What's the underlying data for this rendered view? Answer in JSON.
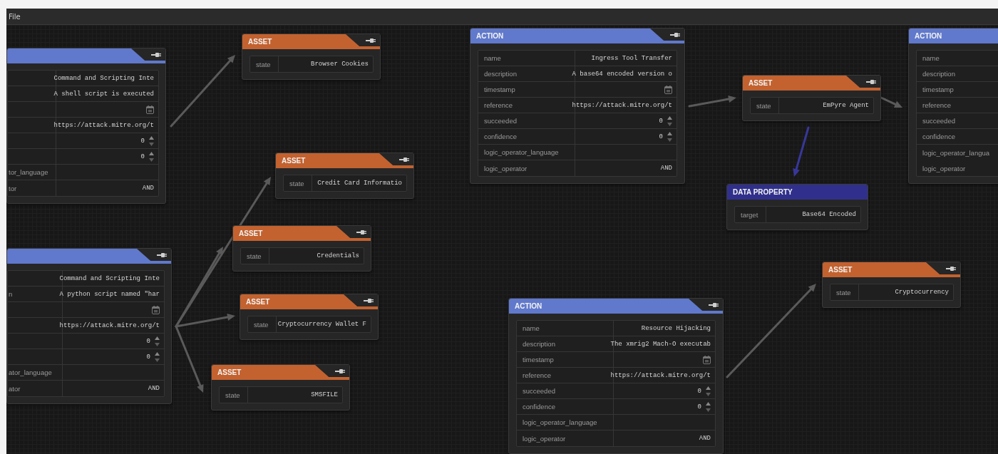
{
  "menu": [
    {
      "label": "File"
    }
  ],
  "nodes": [
    {
      "kind": "action",
      "plug": true,
      "rows": [
        {
          "kind": "text",
          "value": "Command and Scripting Inte"
        },
        {
          "kind": "text",
          "value": "A shell script is executed"
        },
        {
          "kind": "date"
        },
        {
          "kind": "text",
          "value": "https://attack.mitre.org/t"
        },
        {
          "kind": "number",
          "value": "0"
        },
        {
          "kind": "number",
          "value": "0"
        },
        {
          "kind": "text",
          "label": "tor_language"
        },
        {
          "kind": "text",
          "label": "tor",
          "value": "AND"
        }
      ]
    },
    {
      "kind": "action",
      "plug": true,
      "rows": [
        {
          "kind": "text",
          "value": "Command and Scripting Inte"
        },
        {
          "kind": "text",
          "label": "n",
          "value": "A python script named \"har"
        },
        {
          "kind": "date"
        },
        {
          "kind": "text",
          "value": "https://attack.mitre.org/t"
        },
        {
          "kind": "number",
          "value": "0"
        },
        {
          "kind": "number",
          "value": "0"
        },
        {
          "kind": "text",
          "label": "ator_language"
        },
        {
          "kind": "text",
          "label": "ator",
          "value": "AND"
        }
      ]
    },
    {
      "kind": "asset",
      "title": "ASSET",
      "plug": true,
      "rows": [
        {
          "kind": "text",
          "label": "state",
          "value": "Browser Cookies"
        }
      ]
    },
    {
      "kind": "asset",
      "title": "ASSET",
      "plug": true,
      "rows": [
        {
          "kind": "text",
          "label": "state",
          "value": "Credit Card Informatio"
        }
      ]
    },
    {
      "kind": "asset",
      "title": "ASSET",
      "plug": true,
      "rows": [
        {
          "kind": "text",
          "label": "state",
          "value": "Credentials"
        }
      ]
    },
    {
      "kind": "asset",
      "title": "ASSET",
      "plug": true,
      "rows": [
        {
          "kind": "text",
          "label": "state",
          "value": "Cryptocurrency Wallet F"
        }
      ]
    },
    {
      "kind": "asset",
      "title": "ASSET",
      "plug": true,
      "rows": [
        {
          "kind": "text",
          "label": "state",
          "value": "SMSFILE"
        }
      ]
    },
    {
      "kind": "action",
      "title": "ACTION",
      "plug": true,
      "rows": [
        {
          "kind": "text",
          "label": "name",
          "value": "Ingress Tool Transfer"
        },
        {
          "kind": "text",
          "label": "description",
          "value": "A base64 encoded version o"
        },
        {
          "kind": "date",
          "label": "timestamp"
        },
        {
          "kind": "text",
          "label": "reference",
          "value": "https://attack.mitre.org/t"
        },
        {
          "kind": "number",
          "label": "succeeded",
          "value": "0"
        },
        {
          "kind": "number",
          "label": "confidence",
          "value": "0"
        },
        {
          "kind": "text",
          "label": "logic_operator_language"
        },
        {
          "kind": "text",
          "label": "logic_operator",
          "value": "AND"
        }
      ]
    },
    {
      "kind": "asset",
      "title": "ASSET",
      "plug": true,
      "rows": [
        {
          "kind": "text",
          "label": "state",
          "value": "EmPyre Agent"
        }
      ]
    },
    {
      "kind": "data_property",
      "title": "DATA PROPERTY",
      "plug": false,
      "rows": [
        {
          "kind": "text",
          "label": "target",
          "value": "Base64 Encoded"
        }
      ]
    },
    {
      "kind": "action",
      "title": "ACTION",
      "plug": false,
      "rows": [
        {
          "label": "name"
        },
        {
          "label": "description"
        },
        {
          "label": "timestamp"
        },
        {
          "label": "reference"
        },
        {
          "label": "succeeded"
        },
        {
          "label": "confidence"
        },
        {
          "label": "logic_operator_langua"
        },
        {
          "label": "logic_operator"
        }
      ]
    },
    {
      "kind": "asset",
      "title": "ASSET",
      "plug": true,
      "rows": [
        {
          "kind": "text",
          "label": "state",
          "value": "Cryptocurrency"
        }
      ]
    },
    {
      "kind": "action",
      "title": "ACTION",
      "plug": true,
      "rows": [
        {
          "kind": "text",
          "label": "name",
          "value": "Resource Hijacking"
        },
        {
          "kind": "text",
          "label": "description",
          "value": "The xmrig2 Mach-O executab"
        },
        {
          "kind": "date",
          "label": "timestamp"
        },
        {
          "kind": "text",
          "label": "reference",
          "value": "https://attack.mitre.org/t"
        },
        {
          "kind": "number",
          "label": "succeeded",
          "value": "0"
        },
        {
          "kind": "number",
          "label": "confidence",
          "value": "0"
        },
        {
          "kind": "text",
          "label": "logic_operator_language"
        },
        {
          "kind": "text",
          "label": "logic_operator",
          "value": "AND"
        }
      ]
    }
  ]
}
